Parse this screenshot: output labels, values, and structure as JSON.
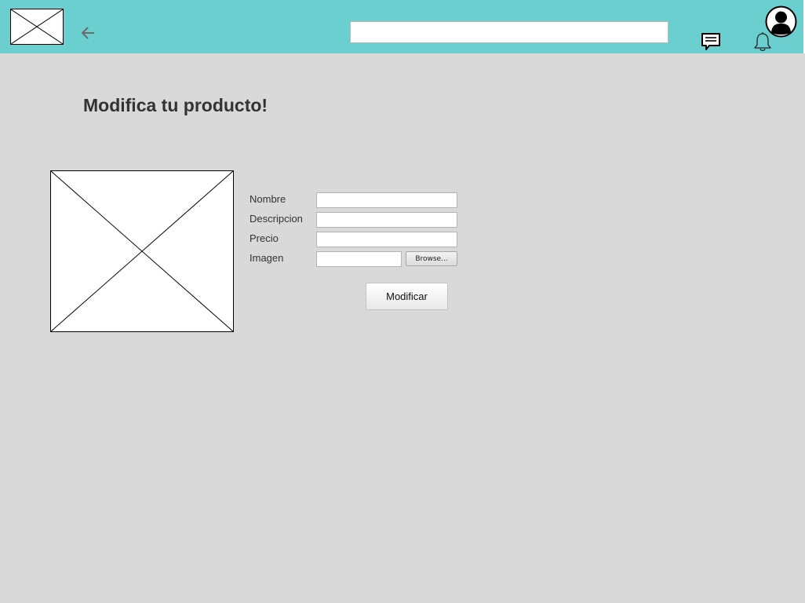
{
  "header": {
    "search": {
      "value": "",
      "placeholder": ""
    },
    "icons": {
      "logo": "image-placeholder-icon",
      "back": "arrow-left-icon",
      "messages": "chat-bubble-icon",
      "notifications": "bell-icon",
      "profile": "user-avatar-icon"
    },
    "colors": {
      "background": "#6ccfcf"
    }
  },
  "main": {
    "title": "Modifica tu producto!",
    "product_image_icon": "image-placeholder-icon",
    "form": {
      "fields": [
        {
          "label": "Nombre",
          "value": ""
        },
        {
          "label": "Descripcion",
          "value": ""
        },
        {
          "label": "Precio",
          "value": ""
        },
        {
          "label": "Imagen",
          "value": ""
        }
      ],
      "browse_label": "Browse...",
      "submit_label": "Modificar"
    }
  },
  "colors": {
    "page_background": "#d9d9d9"
  }
}
